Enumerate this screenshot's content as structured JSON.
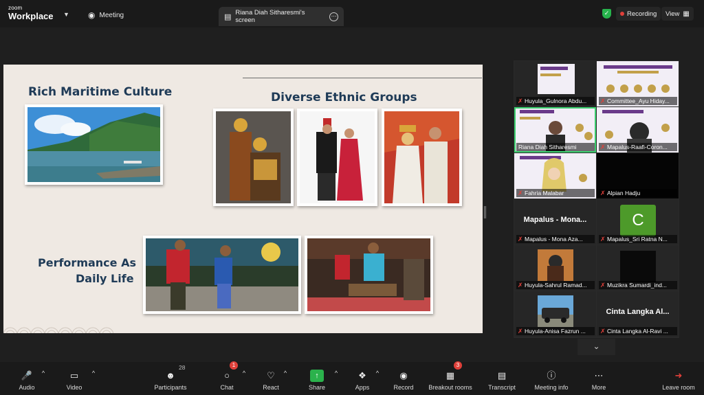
{
  "app": {
    "logo_top": "zoom",
    "logo_main": "Workplace"
  },
  "topbar": {
    "meeting_label": "Meeting",
    "screen_tab": "Riana Diah Sitharesmi's screen",
    "recording_label": "Recording",
    "view_label": "View"
  },
  "slide": {
    "title_maritime": "Rich Maritime Culture",
    "title_ethnic": "Diverse Ethnic Groups",
    "title_performance_1": "Performance As",
    "title_performance_2": "Daily Life"
  },
  "gallery": {
    "tiles": [
      {
        "name": "Huyula_Gulnora Abdu..."
      },
      {
        "name": "Committee_Ayu Hiday..."
      },
      {
        "name": "Riana Diah Sitharesmi"
      },
      {
        "name": "Mapalus-Raafi-Coron..."
      },
      {
        "name": "Fahria Malabar"
      },
      {
        "name": "Alpian Hadju"
      },
      {
        "name": "Mapalus - Mona Aza...",
        "display": "Mapalus - Mona..."
      },
      {
        "name": "Mapalus_Sri Ratna N...",
        "initial": "C"
      },
      {
        "name": "Huyula-Sahrul Ramad..."
      },
      {
        "name": "Muzikra Sumardi_ind..."
      },
      {
        "name": "Huyula-Anisa Fazrun ..."
      },
      {
        "name": "Cinta Langka Al-Ravi ...",
        "display": "Cinta Langka Al..."
      }
    ]
  },
  "toolbar": {
    "audio": "Audio",
    "video": "Video",
    "participants": "Participants",
    "participants_count": "28",
    "chat": "Chat",
    "chat_badge": "1",
    "react": "React",
    "share": "Share",
    "apps": "Apps",
    "record": "Record",
    "breakout": "Breakout rooms",
    "breakout_badge": "3",
    "transcript": "Transcript",
    "meeting_info": "Meeting info",
    "more": "More",
    "leave": "Leave room"
  },
  "colors": {
    "accent_green": "#27b34c",
    "record_red": "#e0403a",
    "share_green": "#2bb24c",
    "slide_bg": "#efe9e3",
    "title_blue": "#1f3b57",
    "active_border": "#3bd16f"
  }
}
